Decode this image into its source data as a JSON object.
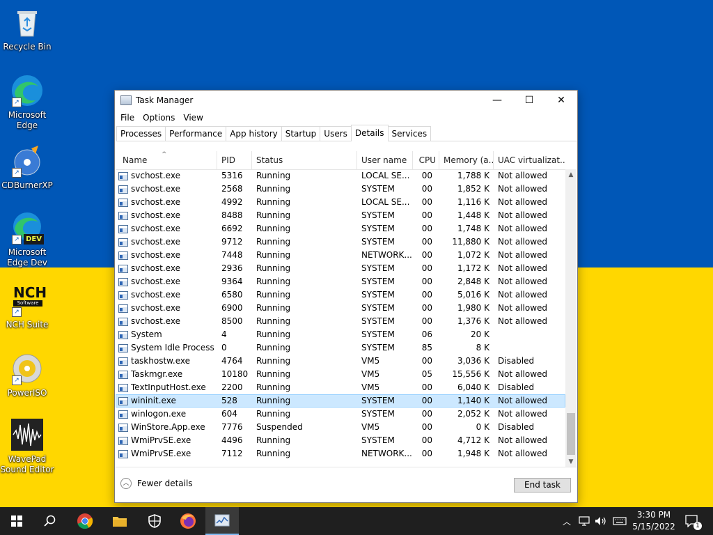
{
  "desktop": {
    "icons": [
      {
        "name": "recycle-bin-icon",
        "label": "Recycle Bin"
      },
      {
        "name": "microsoft-edge-icon",
        "label": "Microsoft Edge"
      },
      {
        "name": "cdburnerxp-icon",
        "label": "CDBurnerXP"
      },
      {
        "name": "microsoft-edge-dev-icon",
        "label": "Microsoft Edge Dev",
        "badge": "DEV"
      },
      {
        "name": "nch-suite-icon",
        "label": "NCH Suite",
        "logo": "NCH",
        "logo_sub": "Software"
      },
      {
        "name": "poweriso-icon",
        "label": "PowerISO"
      },
      {
        "name": "wavepad-icon",
        "label": "WavePad Sound Editor"
      }
    ]
  },
  "window": {
    "title": "Task Manager",
    "menu": [
      "File",
      "Options",
      "View"
    ],
    "tabs": [
      "Processes",
      "Performance",
      "App history",
      "Startup",
      "Users",
      "Details",
      "Services"
    ],
    "active_tab": "Details",
    "columns": [
      "Name",
      "PID",
      "Status",
      "User name",
      "CPU",
      "Memory (a...",
      "UAC virtualizat..."
    ],
    "rows": [
      {
        "name": "svchost.exe",
        "pid": "5316",
        "status": "Running",
        "user": "LOCAL SE...",
        "cpu": "00",
        "mem": "1,788 K",
        "uac": "Not allowed"
      },
      {
        "name": "svchost.exe",
        "pid": "2568",
        "status": "Running",
        "user": "SYSTEM",
        "cpu": "00",
        "mem": "1,852 K",
        "uac": "Not allowed"
      },
      {
        "name": "svchost.exe",
        "pid": "4992",
        "status": "Running",
        "user": "LOCAL SE...",
        "cpu": "00",
        "mem": "1,116 K",
        "uac": "Not allowed"
      },
      {
        "name": "svchost.exe",
        "pid": "8488",
        "status": "Running",
        "user": "SYSTEM",
        "cpu": "00",
        "mem": "1,448 K",
        "uac": "Not allowed"
      },
      {
        "name": "svchost.exe",
        "pid": "6692",
        "status": "Running",
        "user": "SYSTEM",
        "cpu": "00",
        "mem": "1,748 K",
        "uac": "Not allowed"
      },
      {
        "name": "svchost.exe",
        "pid": "9712",
        "status": "Running",
        "user": "SYSTEM",
        "cpu": "00",
        "mem": "11,880 K",
        "uac": "Not allowed"
      },
      {
        "name": "svchost.exe",
        "pid": "7448",
        "status": "Running",
        "user": "NETWORK...",
        "cpu": "00",
        "mem": "1,072 K",
        "uac": "Not allowed"
      },
      {
        "name": "svchost.exe",
        "pid": "2936",
        "status": "Running",
        "user": "SYSTEM",
        "cpu": "00",
        "mem": "1,172 K",
        "uac": "Not allowed"
      },
      {
        "name": "svchost.exe",
        "pid": "9364",
        "status": "Running",
        "user": "SYSTEM",
        "cpu": "00",
        "mem": "2,848 K",
        "uac": "Not allowed"
      },
      {
        "name": "svchost.exe",
        "pid": "6580",
        "status": "Running",
        "user": "SYSTEM",
        "cpu": "00",
        "mem": "5,016 K",
        "uac": "Not allowed"
      },
      {
        "name": "svchost.exe",
        "pid": "6900",
        "status": "Running",
        "user": "SYSTEM",
        "cpu": "00",
        "mem": "1,980 K",
        "uac": "Not allowed"
      },
      {
        "name": "svchost.exe",
        "pid": "8500",
        "status": "Running",
        "user": "SYSTEM",
        "cpu": "00",
        "mem": "1,376 K",
        "uac": "Not allowed"
      },
      {
        "name": "System",
        "pid": "4",
        "status": "Running",
        "user": "SYSTEM",
        "cpu": "06",
        "mem": "20 K",
        "uac": ""
      },
      {
        "name": "System Idle Process",
        "pid": "0",
        "status": "Running",
        "user": "SYSTEM",
        "cpu": "85",
        "mem": "8 K",
        "uac": ""
      },
      {
        "name": "taskhostw.exe",
        "pid": "4764",
        "status": "Running",
        "user": "VM5",
        "cpu": "00",
        "mem": "3,036 K",
        "uac": "Disabled"
      },
      {
        "name": "Taskmgr.exe",
        "pid": "10180",
        "status": "Running",
        "user": "VM5",
        "cpu": "05",
        "mem": "15,556 K",
        "uac": "Not allowed"
      },
      {
        "name": "TextInputHost.exe",
        "pid": "2200",
        "status": "Running",
        "user": "VM5",
        "cpu": "00",
        "mem": "6,040 K",
        "uac": "Disabled"
      },
      {
        "name": "wininit.exe",
        "pid": "528",
        "status": "Running",
        "user": "SYSTEM",
        "cpu": "00",
        "mem": "1,140 K",
        "uac": "Not allowed",
        "selected": true
      },
      {
        "name": "winlogon.exe",
        "pid": "604",
        "status": "Running",
        "user": "SYSTEM",
        "cpu": "00",
        "mem": "2,052 K",
        "uac": "Not allowed"
      },
      {
        "name": "WinStore.App.exe",
        "pid": "7776",
        "status": "Suspended",
        "user": "VM5",
        "cpu": "00",
        "mem": "0 K",
        "uac": "Disabled"
      },
      {
        "name": "WmiPrvSE.exe",
        "pid": "4496",
        "status": "Running",
        "user": "SYSTEM",
        "cpu": "00",
        "mem": "4,712 K",
        "uac": "Not allowed"
      },
      {
        "name": "WmiPrvSE.exe",
        "pid": "7112",
        "status": "Running",
        "user": "NETWORK...",
        "cpu": "00",
        "mem": "1,948 K",
        "uac": "Not allowed"
      }
    ],
    "fewer_details_label": "Fewer details",
    "end_task_label": "End task"
  },
  "taskbar": {
    "clock_time": "3:30 PM",
    "clock_date": "5/15/2022",
    "notification_count": "1"
  },
  "colors": {
    "flag_blue": "#0057b7",
    "flag_yellow": "#ffd700",
    "selection": "#cce8ff",
    "taskbar": "#1f1f1f"
  }
}
